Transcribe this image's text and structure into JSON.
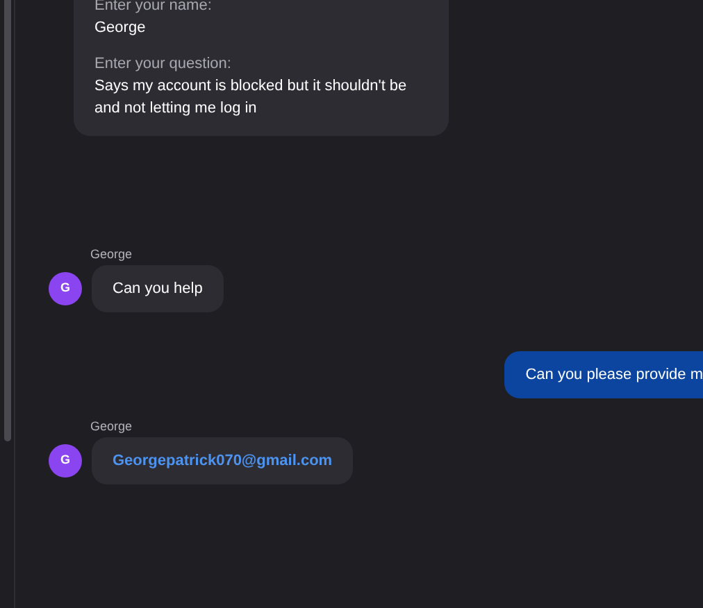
{
  "form_card": {
    "fields": [
      {
        "label": "Enter your name:",
        "value": "George"
      },
      {
        "label": "Enter your question:",
        "value": "Says my account is blocked but it shouldn't be and not letting me log in"
      }
    ]
  },
  "messages": [
    {
      "kind": "incoming",
      "sender": "George",
      "avatar": "G",
      "text": "Can you help",
      "link": false
    },
    {
      "kind": "outgoing",
      "text": "Can you please provide m"
    },
    {
      "kind": "incoming",
      "sender": "George",
      "avatar": "G",
      "text": "Georgepatrick070@gmail.com",
      "link": true
    }
  ]
}
